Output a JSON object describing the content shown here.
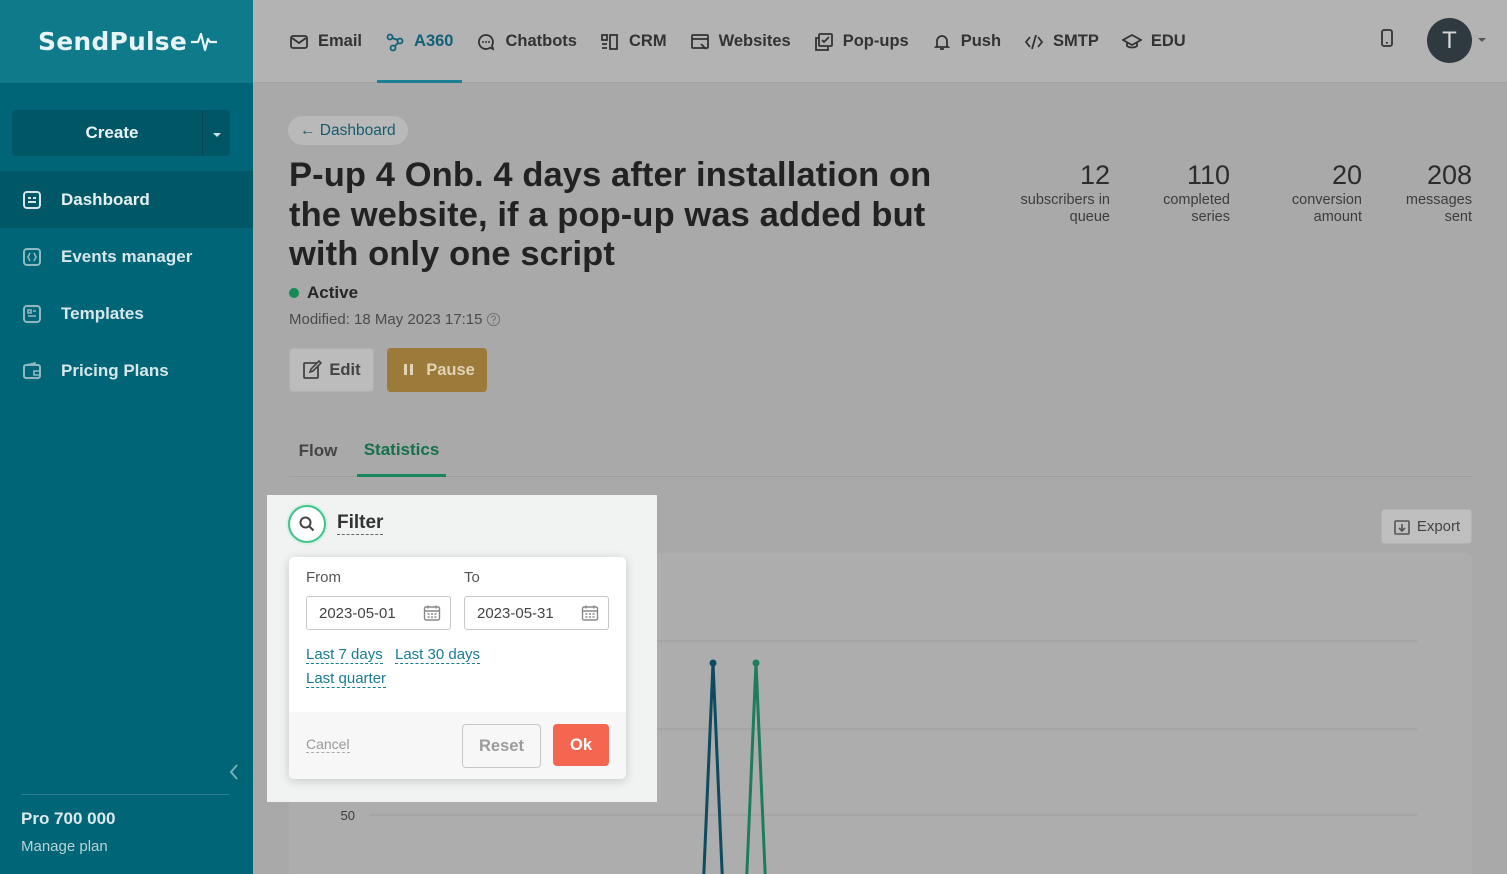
{
  "brand": {
    "name": "SendPulse"
  },
  "sidebar": {
    "create_label": "Create",
    "items": [
      {
        "label": "Dashboard",
        "icon": "dashboard-icon",
        "active": true
      },
      {
        "label": "Events manager",
        "icon": "events-icon",
        "active": false
      },
      {
        "label": "Templates",
        "icon": "templates-icon",
        "active": false
      },
      {
        "label": "Pricing Plans",
        "icon": "wallet-icon",
        "active": false
      }
    ],
    "plan_name": "Pro 700 000",
    "manage_plan": "Manage plan"
  },
  "topnav": {
    "items": [
      {
        "label": "Email",
        "icon": "envelope-icon"
      },
      {
        "label": "A360",
        "icon": "automation-icon",
        "active": true
      },
      {
        "label": "Chatbots",
        "icon": "chat-icon"
      },
      {
        "label": "CRM",
        "icon": "crm-icon"
      },
      {
        "label": "Websites",
        "icon": "website-icon"
      },
      {
        "label": "Pop-ups",
        "icon": "popup-icon"
      },
      {
        "label": "Push",
        "icon": "bell-icon"
      },
      {
        "label": "SMTP",
        "icon": "code-icon"
      },
      {
        "label": "EDU",
        "icon": "graduation-cap-icon"
      }
    ],
    "avatar_initial": "T"
  },
  "page": {
    "breadcrumb": "← Dashboard",
    "title": "P-up 4 Onb. 4 days after installation on the website, if a pop-up was added but with only one script",
    "status": "Active",
    "modified": "Modified: 18 May 2023 17:15",
    "edit_label": "Edit",
    "pause_label": "Pause",
    "export_label": "Export"
  },
  "stats": [
    {
      "value": "12",
      "label_line1": "subscribers in",
      "label_line2": "queue"
    },
    {
      "value": "110",
      "label_line1": "completed",
      "label_line2": "series"
    },
    {
      "value": "20",
      "label_line1": "conversion",
      "label_line2": "amount"
    },
    {
      "value": "208",
      "label_line1": "messages",
      "label_line2": "sent"
    }
  ],
  "tabs": [
    {
      "label": "Flow",
      "active": false
    },
    {
      "label": "Statistics",
      "active": true
    }
  ],
  "filter": {
    "label": "Filter",
    "from_label": "From",
    "to_label": "To",
    "from_value": "2023-05-01",
    "to_value": "2023-05-31",
    "quick": [
      "Last 7 days",
      "Last 30 days",
      "Last quarter"
    ],
    "cancel_label": "Cancel",
    "reset_label": "Reset",
    "ok_label": "Ok"
  },
  "chart_data": {
    "type": "line",
    "ytick_labels": [
      "50"
    ],
    "series": [
      {
        "color": "#0f4a63",
        "peak_index": 0
      },
      {
        "color": "#1d7c5c",
        "peak_index": 1
      }
    ]
  },
  "colors": {
    "sidebar": "#006577",
    "accent": "#17865a",
    "pause": "#9c7a3a",
    "ok": "#f4664f"
  }
}
